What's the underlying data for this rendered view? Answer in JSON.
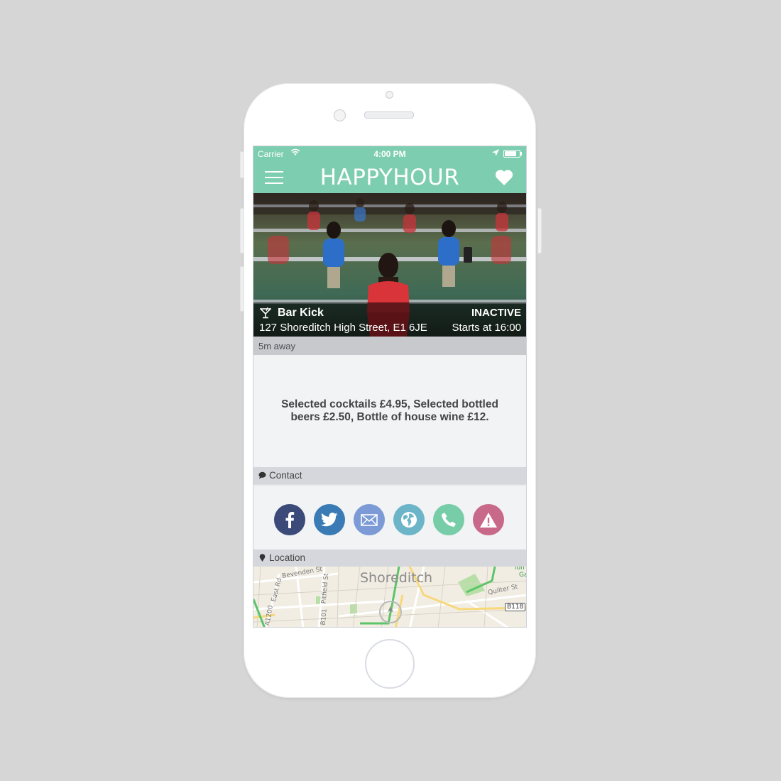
{
  "status_bar": {
    "carrier": "Carrier",
    "time": "4:00 PM"
  },
  "nav": {
    "brand": "HAPPYHOUR"
  },
  "venue": {
    "name": "Bar Kick",
    "address": "127 Shoreditch High Street, E1 6JE",
    "status": "INACTIVE",
    "starts": "Starts at 16:00",
    "distance": "5m away"
  },
  "deal": {
    "text": "Selected cocktails £4.95, Selected bottled beers £2.50, Bottle of house wine £12."
  },
  "contact": {
    "header": "Contact",
    "buttons": [
      {
        "icon": "facebook-icon",
        "color": "#3b4a78"
      },
      {
        "icon": "twitter-icon",
        "color": "#3a7bb5"
      },
      {
        "icon": "mail-icon",
        "color": "#7b9ad6"
      },
      {
        "icon": "globe-icon",
        "color": "#6cb4c8"
      },
      {
        "icon": "phone-icon",
        "color": "#78cda9"
      },
      {
        "icon": "warning-icon",
        "color": "#c8698a"
      }
    ]
  },
  "location": {
    "header": "Location",
    "map_labels": {
      "area": "Shoreditch",
      "bevenden": "Bevenden St",
      "east_rd": "East Rd",
      "pitfield": "Pitfield St",
      "quilter": "Quilter St",
      "a1200": "A1200",
      "b101": "B101",
      "b118": "B118",
      "corner": "ion",
      "corner2": "Ga"
    }
  },
  "colors": {
    "brand_green": "#7dcdb0",
    "background": "#d6d6d6"
  }
}
